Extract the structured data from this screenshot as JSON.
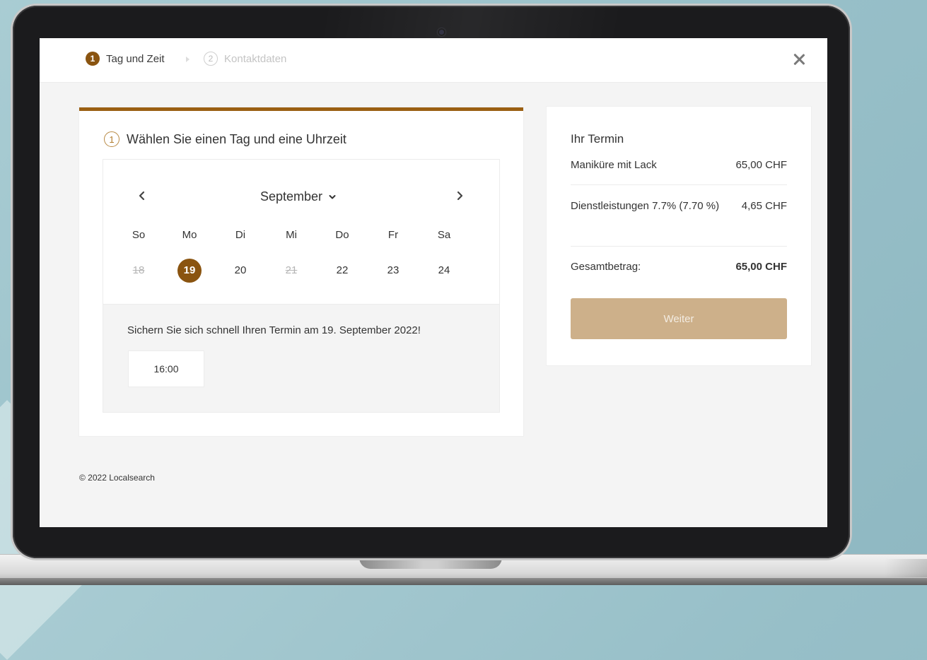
{
  "steps": [
    {
      "num": "1",
      "label": "Tag und Zeit"
    },
    {
      "num": "2",
      "label": "Kontaktdaten"
    }
  ],
  "section": {
    "num": "1",
    "title": "Wählen Sie einen Tag und eine Uhrzeit"
  },
  "calendar": {
    "month": "September",
    "weekdays": [
      "So",
      "Mo",
      "Di",
      "Mi",
      "Do",
      "Fr",
      "Sa"
    ],
    "days": [
      {
        "label": "18",
        "state": "disabled"
      },
      {
        "label": "19",
        "state": "selected"
      },
      {
        "label": "20",
        "state": "available"
      },
      {
        "label": "21",
        "state": "disabled"
      },
      {
        "label": "22",
        "state": "available"
      },
      {
        "label": "23",
        "state": "available"
      },
      {
        "label": "24",
        "state": "available"
      }
    ]
  },
  "times": {
    "message": "Sichern Sie sich schnell Ihren Termin am 19. September 2022!",
    "slots": [
      "16:00"
    ]
  },
  "summary": {
    "title": "Ihr Termin",
    "items": [
      {
        "label": "Maniküre mit Lack",
        "value": "65,00 CHF"
      },
      {
        "label": "Dienstleistungen 7.7% (7.70 %)",
        "value": "4,65 CHF"
      }
    ],
    "total_label": "Gesamtbetrag:",
    "total_value": "65,00 CHF",
    "next_label": "Weiter"
  },
  "footer": "© 2022 Localsearch",
  "colors": {
    "accent": "#8a5410",
    "accent_bar": "#9a5f12",
    "button": "#cdb08a",
    "background": "#97bfc8"
  },
  "icons": {
    "close": "close-icon",
    "prev": "chevron-left-icon",
    "next": "chevron-right-icon",
    "month_dropdown": "chevron-down-icon"
  }
}
